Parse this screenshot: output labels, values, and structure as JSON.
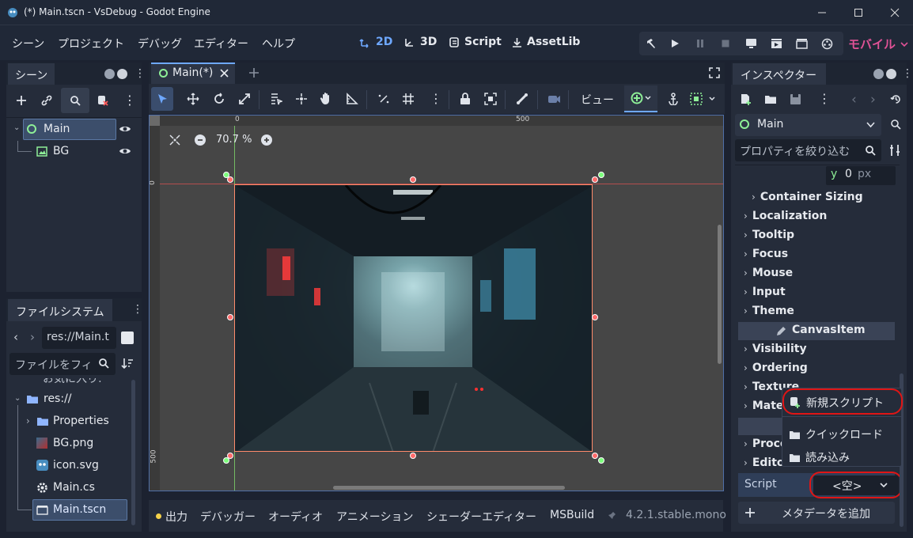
{
  "window": {
    "title": "(*) Main.tscn - VsDebug - Godot Engine"
  },
  "menu": {
    "items": [
      "シーン",
      "プロジェクト",
      "デバッグ",
      "エディター",
      "ヘルプ"
    ]
  },
  "modes": {
    "mode_2d": "2D",
    "mode_3d": "3D",
    "script": "Script",
    "assetlib": "AssetLib"
  },
  "renderer": {
    "label": "モバイル"
  },
  "scene_dock": {
    "tab": "シーン",
    "nodes": [
      {
        "name": "Main"
      },
      {
        "name": "BG"
      }
    ]
  },
  "filesystem_dock": {
    "tab": "ファイルシステム",
    "path": "res://Main.t",
    "filter_placeholder": "ファイルをフィ",
    "favorites_label": "お気に入り:",
    "root": "res://",
    "items": [
      "Properties",
      "BG.png",
      "icon.svg",
      "Main.cs",
      "Main.tscn"
    ]
  },
  "editor_tabs": {
    "main_tab": "Main(*)"
  },
  "toolbar": {
    "view_label": "ビュー"
  },
  "viewport": {
    "zoom": "70.7 %",
    "ruler_top": [
      "0",
      "500"
    ],
    "ruler_left": [
      "0",
      "500"
    ]
  },
  "inspector": {
    "tab": "インスペクター",
    "node_selector": "Main",
    "filter_placeholder": "プロパティを絞り込む",
    "y_label": "y",
    "y_value": "0",
    "y_unit": "px",
    "sections": [
      "Container Sizing",
      "Localization",
      "Tooltip",
      "Focus",
      "Mouse",
      "Input",
      "Theme"
    ],
    "category": "CanvasItem",
    "canvas_sections": [
      "Visibility",
      "Ordering",
      "Texture",
      "Mate"
    ],
    "object_sections": [
      "Proces",
      "Editor"
    ],
    "script_label": "Script",
    "script_value": "<空>",
    "add_metadata": "メタデータを追加"
  },
  "popup": {
    "new_script": "新規スクリプト",
    "quick_load": "クイックロード",
    "load": "読み込み"
  },
  "bottom_panel": {
    "tabs": [
      "出力",
      "デバッガー",
      "オーディオ",
      "アニメーション",
      "シェーダーエディター",
      "MSBuild"
    ],
    "version": "4.2.1.stable.mono"
  },
  "colors": {
    "accent": "#6ea8ff",
    "renderer": "#e05296",
    "highlight_ring": "#e01515"
  }
}
